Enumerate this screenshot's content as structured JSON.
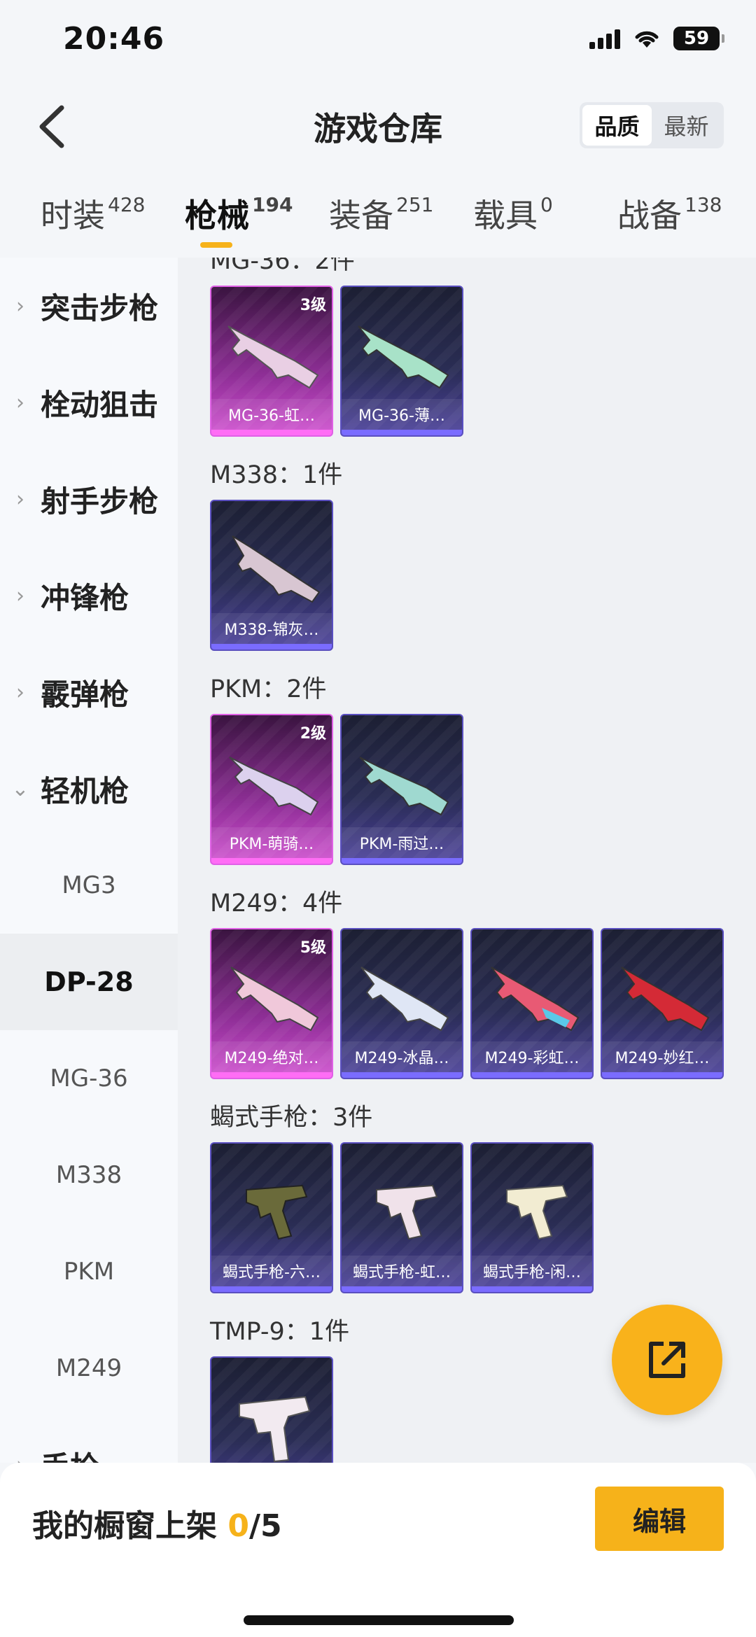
{
  "status": {
    "time": "20:46",
    "battery": "59"
  },
  "header": {
    "title": "游戏仓库",
    "sort_options": [
      "品质",
      "最新"
    ],
    "active_sort": "品质"
  },
  "tabs": [
    {
      "label": "时装",
      "count": "428"
    },
    {
      "label": "枪械",
      "count": "194"
    },
    {
      "label": "装备",
      "count": "251"
    },
    {
      "label": "载具",
      "count": "0"
    },
    {
      "label": "战备",
      "count": "138"
    }
  ],
  "sidebar": {
    "categories": [
      "突击步枪",
      "栓动狙击",
      "射手步枪",
      "冲锋枪",
      "霰弹枪",
      "轻机枪"
    ],
    "subitems": [
      "MG3",
      "DP-28",
      "MG-36",
      "M338",
      "PKM",
      "M249"
    ],
    "partial_next": "手枪"
  },
  "groups": [
    {
      "title": "MG-36：2件",
      "items": [
        {
          "name": "MG-36-虹…",
          "level": "3级"
        },
        {
          "name": "MG-36-薄…",
          "level": ""
        }
      ]
    },
    {
      "title": "M338：1件",
      "items": [
        {
          "name": "M338-锦灰…",
          "level": ""
        }
      ]
    },
    {
      "title": "PKM：2件",
      "items": [
        {
          "name": "PKM-萌骑…",
          "level": "2级"
        },
        {
          "name": "PKM-雨过…",
          "level": ""
        }
      ]
    },
    {
      "title": "M249：4件",
      "items": [
        {
          "name": "M249-绝对…",
          "level": "5级"
        },
        {
          "name": "M249-冰晶…",
          "level": ""
        },
        {
          "name": "M249-彩虹…",
          "level": ""
        },
        {
          "name": "M249-妙红…",
          "level": ""
        }
      ]
    },
    {
      "title": "蝎式手枪：3件",
      "items": [
        {
          "name": "蝎式手枪-六…",
          "level": ""
        },
        {
          "name": "蝎式手枪-虹…",
          "level": ""
        },
        {
          "name": "蝎式手枪-闲…",
          "level": ""
        }
      ]
    },
    {
      "title": "TMP-9：1件",
      "items": [
        {
          "name": "",
          "level": ""
        }
      ]
    }
  ],
  "bottom": {
    "shelf_label": "我的橱窗上架 ",
    "shelf_count": "0",
    "shelf_total": "/5",
    "edit_label": "编辑"
  }
}
